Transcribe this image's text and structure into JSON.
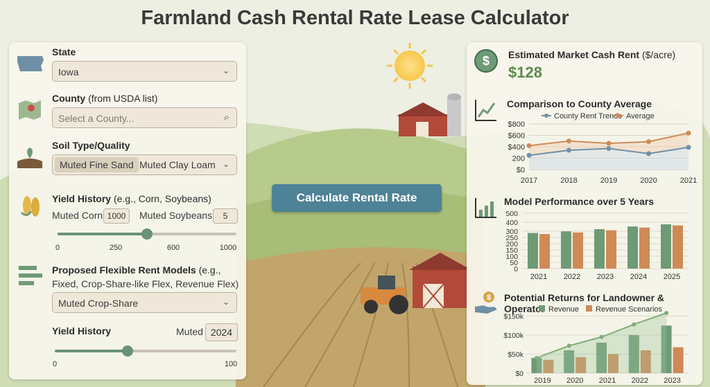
{
  "page": {
    "title": "Farmland Cash Rental Rate Lease Calculator"
  },
  "left": {
    "state": {
      "label": "State",
      "value": "Iowa"
    },
    "county": {
      "label": "County",
      "label_suffix": "(from USDA list)",
      "placeholder": "Select a County..."
    },
    "soil": {
      "label": "Soil Type/Quality",
      "option_selected": "Muted Fine Sand",
      "option_other": "Muted Clay Loam"
    },
    "yield": {
      "label": "Yield History",
      "label_suffix": "(e.g., Corn, Soybeans)",
      "corn_label": "Muted Corn",
      "corn_value": "1000",
      "soy_label": "Muted Soybeans",
      "soy_value": "5",
      "slider_value": 500,
      "ticks": [
        "0",
        "250",
        "600",
        "1000"
      ]
    },
    "models": {
      "label": "Proposed Flexible Rent Models",
      "label_suffix": "(e.g.,",
      "label_line2": "Fixed, Crop-Share-like Flex, Revenue Flex)",
      "value": "Muted Crop-Share"
    },
    "yield2": {
      "label": "Yield History",
      "muted_label": "Muted",
      "year_value": "2024",
      "slider_value": 40,
      "ticks": [
        "0",
        "100"
      ]
    }
  },
  "calculate_button": "Calculate Rental Rate",
  "right": {
    "estimate": {
      "label": "Estimated Market Cash Rent",
      "label_suffix": "($/acre)",
      "value": "$128",
      "icon": "dollar-coin-icon"
    },
    "comparison": {
      "label": "Comparison to County Average"
    },
    "performance": {
      "label": "Model Performance over 5 Years"
    },
    "returns": {
      "label": "Potential Returns for Landowner & Operator"
    }
  },
  "colors": {
    "blue": "#6f8fa6",
    "orange": "#cf8a56",
    "green": "#6e9a76",
    "accent": "#4e8296"
  },
  "chart_data": [
    {
      "type": "line",
      "x": [
        "2017",
        "2018",
        "2019",
        "2020",
        "2021"
      ],
      "series": [
        {
          "name": "County Rent Trends",
          "values": [
            250,
            340,
            370,
            280,
            390
          ]
        },
        {
          "name": "Average",
          "values": [
            420,
            500,
            460,
            490,
            640
          ]
        }
      ],
      "yticks": [
        "$0",
        "200",
        "$400",
        "$600",
        "$800"
      ],
      "ylim": [
        0,
        800
      ],
      "legend": "top"
    },
    {
      "type": "bar",
      "categories": [
        "2021",
        "2022",
        "2023",
        "2024",
        "2025"
      ],
      "series": [
        {
          "values": [
            330,
            345,
            365,
            390,
            410
          ]
        },
        {
          "values": [
            320,
            335,
            355,
            380,
            400
          ]
        }
      ],
      "yticks": [
        "0",
        "50",
        "100",
        "150",
        "200",
        "250",
        "300",
        "400",
        "500"
      ],
      "ylim": [
        0,
        500
      ]
    },
    {
      "type": "bar",
      "categories": [
        "2019",
        "2020",
        "2021",
        "2022",
        "2023"
      ],
      "series": [
        {
          "name": "Revenue",
          "values": [
            40,
            60,
            80,
            100,
            125
          ]
        },
        {
          "name": "Revenue Scenarios",
          "values": [
            35,
            42,
            50,
            60,
            68
          ]
        }
      ],
      "trend": [
        40,
        72,
        95,
        128,
        158
      ],
      "yticks": [
        "$0",
        "$50k",
        "$100k",
        "$150k"
      ],
      "ylim": [
        0,
        160
      ],
      "legend": "top"
    }
  ]
}
